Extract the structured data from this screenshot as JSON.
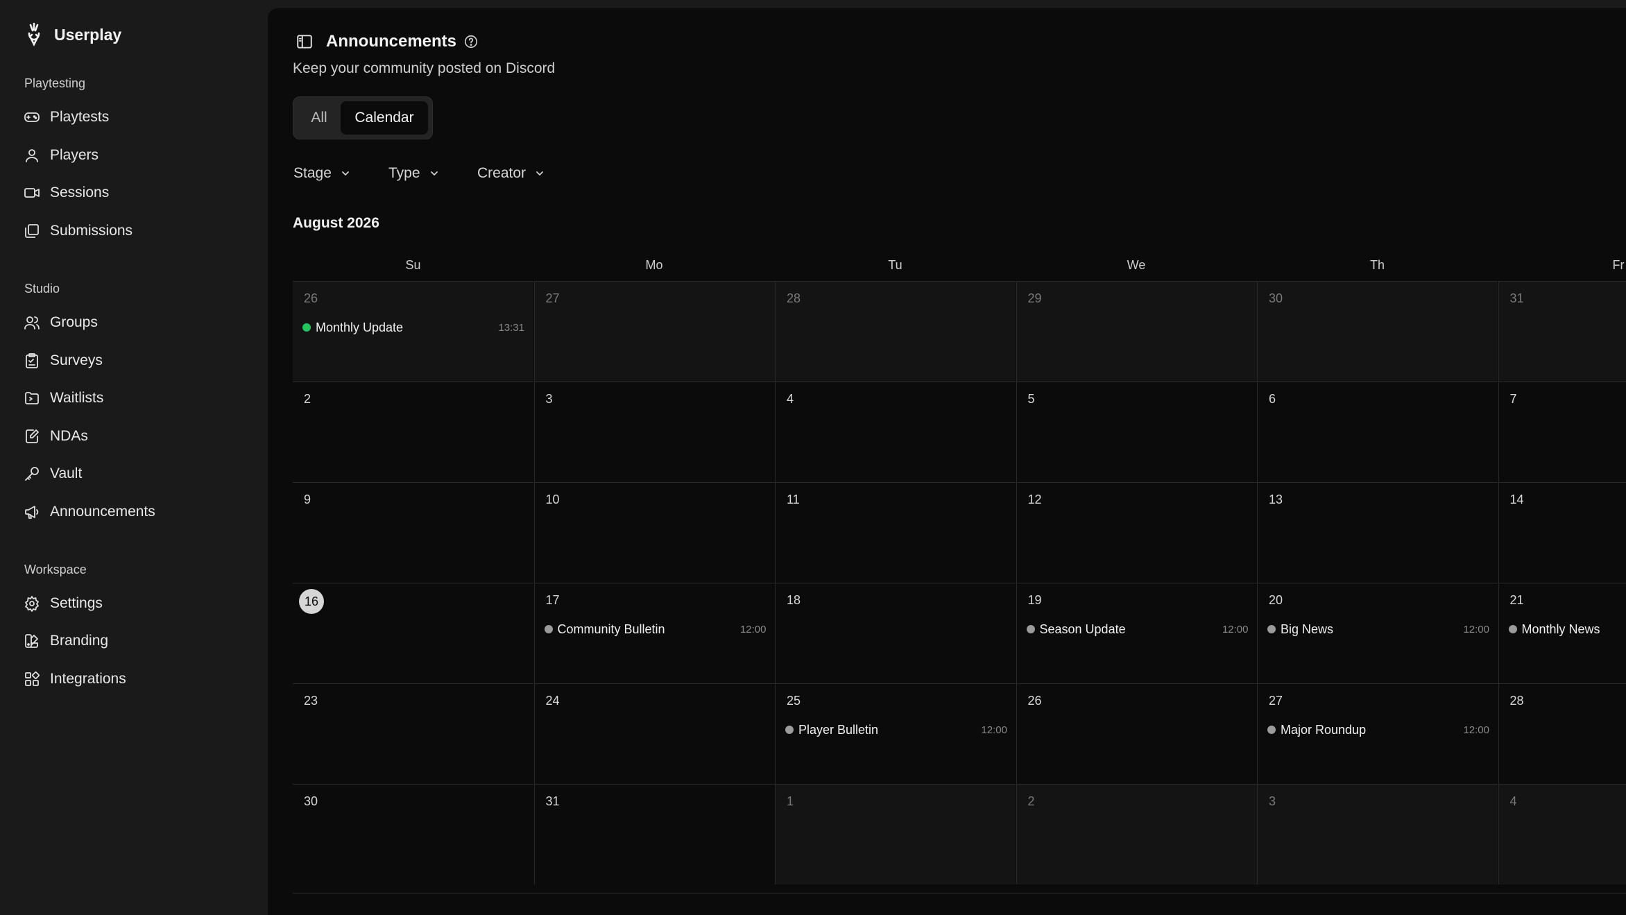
{
  "brand": {
    "name": "Userplay"
  },
  "sidebar": {
    "sections": [
      {
        "title": "Playtesting",
        "items": [
          {
            "label": "Playtests",
            "icon": "gamepad-icon"
          },
          {
            "label": "Players",
            "icon": "user-icon"
          },
          {
            "label": "Sessions",
            "icon": "video-icon"
          },
          {
            "label": "Submissions",
            "icon": "submissions-icon"
          }
        ]
      },
      {
        "title": "Studio",
        "items": [
          {
            "label": "Groups",
            "icon": "users-icon"
          },
          {
            "label": "Surveys",
            "icon": "survey-icon"
          },
          {
            "label": "Waitlists",
            "icon": "waitlist-icon"
          },
          {
            "label": "NDAs",
            "icon": "document-edit-icon"
          },
          {
            "label": "Vault",
            "icon": "key-icon"
          },
          {
            "label": "Announcements",
            "icon": "megaphone-icon"
          }
        ]
      },
      {
        "title": "Workspace",
        "items": [
          {
            "label": "Settings",
            "icon": "gear-icon"
          },
          {
            "label": "Branding",
            "icon": "palette-icon"
          },
          {
            "label": "Integrations",
            "icon": "integrations-icon"
          }
        ]
      }
    ]
  },
  "header": {
    "title": "Announcements",
    "subtitle": "Keep your community posted on Discord"
  },
  "view_toggle": {
    "all": "All",
    "calendar": "Calendar",
    "selected": "Calendar"
  },
  "filters": [
    "Stage",
    "Type",
    "Creator"
  ],
  "calendar": {
    "month_label": "August 2026",
    "weekdays": [
      "Su",
      "Mo",
      "Tu",
      "We",
      "Th",
      "Fr"
    ],
    "weeks": [
      [
        {
          "day": "26",
          "other": true,
          "events": [
            {
              "title": "Monthly Update",
              "time": "13:31",
              "color": "#22c55e"
            }
          ]
        },
        {
          "day": "27",
          "other": true
        },
        {
          "day": "28",
          "other": true
        },
        {
          "day": "29",
          "other": true
        },
        {
          "day": "30",
          "other": true
        },
        {
          "day": "31",
          "other": true
        }
      ],
      [
        {
          "day": "2"
        },
        {
          "day": "3"
        },
        {
          "day": "4"
        },
        {
          "day": "5"
        },
        {
          "day": "6"
        },
        {
          "day": "7"
        }
      ],
      [
        {
          "day": "9"
        },
        {
          "day": "10"
        },
        {
          "day": "11"
        },
        {
          "day": "12"
        },
        {
          "day": "13"
        },
        {
          "day": "14"
        }
      ],
      [
        {
          "day": "16",
          "today": true
        },
        {
          "day": "17",
          "events": [
            {
              "title": "Community Bulletin",
              "time": "12:00"
            }
          ]
        },
        {
          "day": "18"
        },
        {
          "day": "19",
          "events": [
            {
              "title": "Season Update",
              "time": "12:00"
            }
          ]
        },
        {
          "day": "20",
          "events": [
            {
              "title": "Big News",
              "time": "12:00"
            }
          ]
        },
        {
          "day": "21",
          "events": [
            {
              "title": "Monthly News",
              "time": ""
            }
          ]
        }
      ],
      [
        {
          "day": "23"
        },
        {
          "day": "24"
        },
        {
          "day": "25",
          "events": [
            {
              "title": "Player Bulletin",
              "time": "12:00"
            }
          ]
        },
        {
          "day": "26"
        },
        {
          "day": "27",
          "events": [
            {
              "title": "Major Roundup",
              "time": "12:00"
            }
          ]
        },
        {
          "day": "28"
        }
      ],
      [
        {
          "day": "30"
        },
        {
          "day": "31"
        },
        {
          "day": "1",
          "other": true
        },
        {
          "day": "2",
          "other": true
        },
        {
          "day": "3",
          "other": true
        },
        {
          "day": "4",
          "other": true
        }
      ]
    ]
  }
}
